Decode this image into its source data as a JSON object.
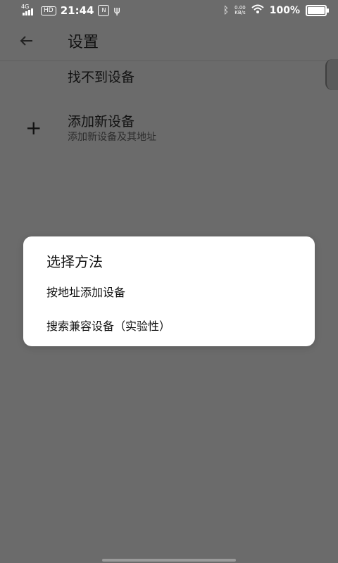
{
  "status_bar": {
    "network_label": "4G",
    "hd_label": "HD",
    "time": "21:44",
    "box_icon_label": "N",
    "usb_icon": "usb-icon",
    "speed_value": "0.00",
    "speed_unit": "KB/s",
    "battery_percent": "100%",
    "battery_level": 1.0
  },
  "app_bar": {
    "title": "设置"
  },
  "content": {
    "cant_find_device": "找不到设备",
    "add_device": {
      "title": "添加新设备",
      "subtitle": "添加新设备及其地址"
    }
  },
  "dialog": {
    "title": "选择方法",
    "options": [
      "按地址添加设备",
      "搜索兼容设备（实验性）"
    ]
  },
  "colors": {
    "dim_background": "#6b6b6b",
    "dialog_background": "#ffffff"
  }
}
